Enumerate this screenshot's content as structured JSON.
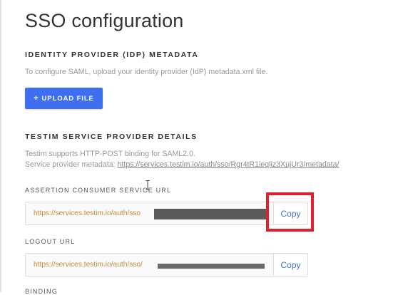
{
  "page": {
    "title": "SSO configuration"
  },
  "idp": {
    "section_title": "IDENTITY PROVIDER (IDP) METADATA",
    "description": "To configure SAML, upload your identity provider (IdP) metadata.xml file.",
    "upload_button": {
      "icon": "plus-icon",
      "icon_glyph": "+",
      "label": "UPLOAD FILE"
    }
  },
  "sp": {
    "section_title": "TESTIM SERVICE PROVIDER DETAILS",
    "binding_note": "Testim supports HTTP-POST binding for SAML2.0.",
    "metadata_label": "Service provider metadata:",
    "metadata_url": "https://services.testim.io/auth/sso/Rgr4tR1ieqliz3XujUr3/metadata/"
  },
  "acs": {
    "label": "ASSERTION CONSUMER SERVICE URL",
    "url_visible": "https://services.testim.io/auth/sso",
    "copy_label": "Copy"
  },
  "logout": {
    "label": "LOGOUT URL",
    "url_visible": "https://services.testim.io/auth/sso/",
    "copy_label": "Copy"
  },
  "binding": {
    "label": "BINDING"
  },
  "colors": {
    "primary": "#3d6ff0",
    "link": "#3f6fd1",
    "url_text": "#c58a3a",
    "highlight": "#e0202e"
  }
}
